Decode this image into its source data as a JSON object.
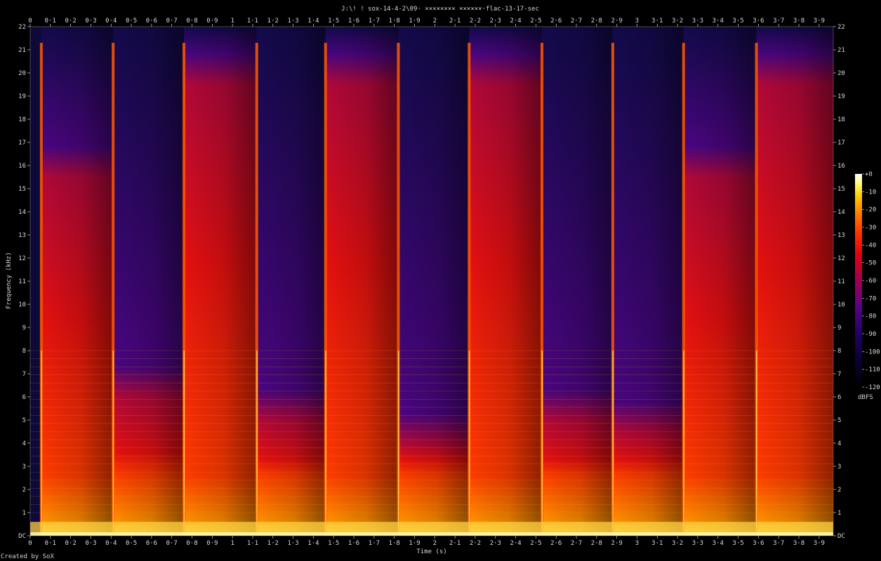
{
  "chart_data": {
    "type": "heatmap",
    "title": "J:\\! ! sox-14-4-2\\09· ×××××××× ××××××·flac-13-17-sec",
    "xlabel": "Time (s)",
    "ylabel": "Frequency (kHz)",
    "xlim": [
      0,
      3.97
    ],
    "ylim": [
      0,
      22
    ],
    "x_ticks": [
      "0",
      "0·1",
      "0·2",
      "0·3",
      "0·4",
      "0·5",
      "0·6",
      "0·7",
      "0·8",
      "0·9",
      "1",
      "1·1",
      "1·2",
      "1·3",
      "1·4",
      "1·5",
      "1·6",
      "1·7",
      "1·8",
      "1·9",
      "2",
      "2·1",
      "2·2",
      "2·3",
      "2·4",
      "2·5",
      "2·6",
      "2·7",
      "2·8",
      "2·9",
      "3",
      "3·1",
      "3·2",
      "3·3",
      "3·4",
      "3·5",
      "3·6",
      "3·7",
      "3·8",
      "3·9"
    ],
    "y_ticks": [
      "DC",
      "1",
      "2",
      "3",
      "4",
      "5",
      "6",
      "7",
      "8",
      "9",
      "10",
      "11",
      "12",
      "13",
      "14",
      "15",
      "16",
      "17",
      "18",
      "19",
      "20",
      "21",
      "22"
    ],
    "colorbar": {
      "label": "dBFS",
      "range": [
        -120,
        0
      ],
      "ticks": [
        "+0",
        "-10",
        "-20",
        "-30",
        "-40",
        "-50",
        "-60",
        "-70",
        "-80",
        "-90",
        "-100",
        "-110",
        "-120"
      ],
      "colors": [
        "#ffffff",
        "#ffff80",
        "#ffd000",
        "#ff8000",
        "#ff3000",
        "#e00010",
        "#b00040",
        "#7a0070",
        "#4a0080",
        "#220066",
        "#0a0033",
        "#000000"
      ]
    },
    "onsets_s": [
      0.055,
      0.41,
      0.76,
      1.12,
      1.46,
      1.82,
      2.17,
      2.53,
      2.88,
      3.23,
      3.59
    ],
    "segments": [
      {
        "start": 0.055,
        "end": 0.41,
        "bright_to_khz": 15.5
      },
      {
        "start": 0.41,
        "end": 0.76,
        "bright_to_khz": 6.0
      },
      {
        "start": 0.76,
        "end": 1.12,
        "bright_to_khz": 19.5
      },
      {
        "start": 1.12,
        "end": 1.46,
        "bright_to_khz": 5.0
      },
      {
        "start": 1.46,
        "end": 1.82,
        "bright_to_khz": 19.5
      },
      {
        "start": 1.82,
        "end": 2.17,
        "bright_to_khz": 4.0
      },
      {
        "start": 2.17,
        "end": 2.53,
        "bright_to_khz": 19.5
      },
      {
        "start": 2.53,
        "end": 2.88,
        "bright_to_khz": 5.0
      },
      {
        "start": 2.88,
        "end": 3.23,
        "bright_to_khz": 4.5
      },
      {
        "start": 3.23,
        "end": 3.59,
        "bright_to_khz": 15.5
      },
      {
        "start": 3.59,
        "end": 3.97,
        "bright_to_khz": 19.5
      }
    ]
  },
  "footer": {
    "credit": "Created by SoX"
  }
}
